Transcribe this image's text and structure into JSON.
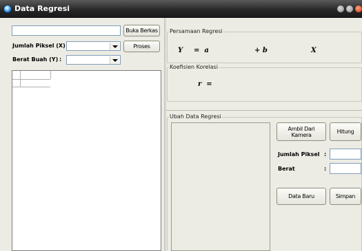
{
  "window": {
    "title": "Data Regresi"
  },
  "file": {
    "path_value": "",
    "open_button": "Buka Berkas"
  },
  "pixel": {
    "label": "Jumlah Piksel (X) :",
    "value": ""
  },
  "process_button": "Proses",
  "weight": {
    "label": "Berat Buah (Y)",
    "separator": ":",
    "value": ""
  },
  "regression": {
    "group_title": "Persamaan Regresi",
    "y_symbol": "Y",
    "equals_a": "=  a",
    "plus_b": "+ b",
    "x_symbol": "X"
  },
  "correlation": {
    "group_title": "Koefisien Korelasi",
    "r_equals": "r  ="
  },
  "edit": {
    "group_title": "Ubah Data Regresi",
    "camera_button": "Ambil Dari Kamera",
    "compute_button": "Hitung",
    "pixel_label": "Jumlah Piksel",
    "pixel_sep": ":",
    "pixel_value": "",
    "weight_label": "Berat",
    "weight_sep": ":",
    "weight_value": "",
    "new_button": "Data Baru",
    "save_button": "Simpan"
  }
}
